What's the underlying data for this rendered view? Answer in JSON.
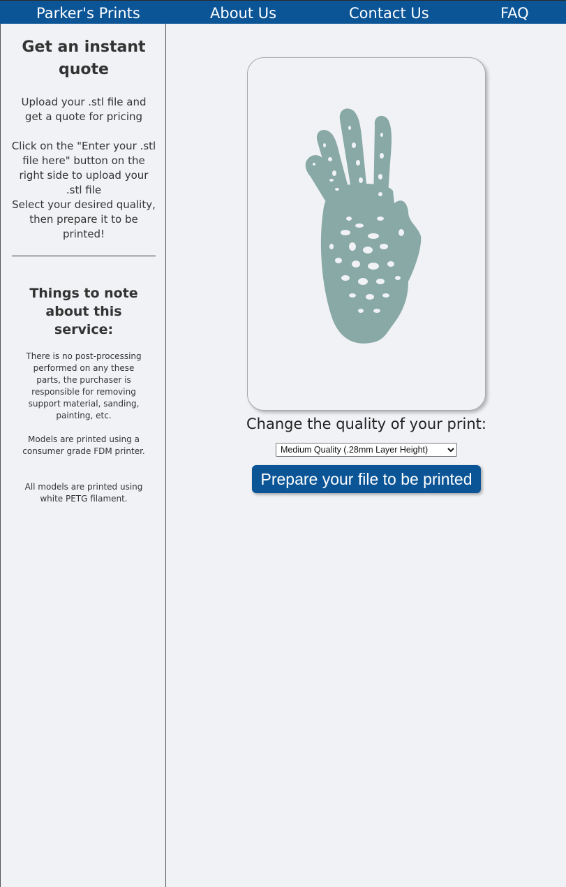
{
  "nav": {
    "brand": "Parker's Prints",
    "links": [
      "About Us",
      "Contact Us",
      "FAQ"
    ]
  },
  "sidebar": {
    "title": "Get an instant quote",
    "paragraphs": [
      "Upload your .stl file and get a quote for pricing",
      "Click on the \"Enter your .stl file here\" button on the right side to upload your .stl file",
      "Select your desired quality, then prepare it to be printed!"
    ],
    "notes_title": "Things to note about this service:",
    "notes": [
      "There is no post-processing performed on any these parts, the purchaser is responsible for removing support material, sanding, painting, etc.",
      "Models are printed using a consumer grade FDM printer.",
      "All models are printed using white PETG filament."
    ]
  },
  "main": {
    "preview_icon": "hand-model-preview",
    "quality_label": "Change the quality of your print:",
    "quality_selected": "Medium Quality (.28mm Layer Height)",
    "prepare_button": "Prepare your file to be printed"
  },
  "colors": {
    "nav_bg": "#0b5597",
    "page_bg": "#f0f2f5",
    "model": "#88a9a6"
  }
}
